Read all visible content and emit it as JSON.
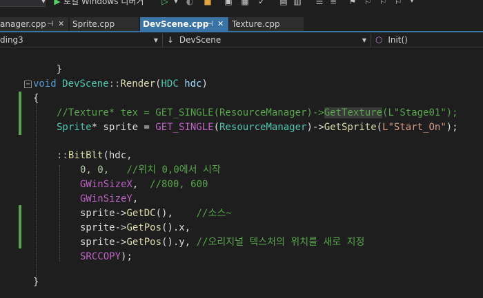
{
  "toolbar": {
    "debug_target": "로컬 Windows 디버거"
  },
  "tabs": [
    {
      "label": "anager.cpp",
      "active": false,
      "pinned": true
    },
    {
      "label": "Sprite.cpp",
      "active": false,
      "pinned": false
    },
    {
      "label": "DevScene.cpp",
      "active": true,
      "pinned": true
    },
    {
      "label": "Texture.cpp",
      "active": false,
      "pinned": false
    }
  ],
  "navbar": {
    "project": "ding3",
    "scope": "DevScene",
    "member": "Init()"
  },
  "code": {
    "l0": "}",
    "l1_void": "void",
    "l1_class": "DevScene",
    "l1_sep": "::",
    "l1_fn": "Render",
    "l1_open": "(",
    "l1_type": "HDC",
    "l1_param": " hdc",
    "l1_close": ")",
    "l2": "{",
    "l3_comment1": "//Texture* tex = GET_SINGLE(ResourceManager)->",
    "l3_comment_hl": "GetTexture",
    "l3_comment2": "(L\"Stage01\");",
    "l4_type": "Sprite",
    "l4_a": "* sprite = ",
    "l4_macro": "GET_SINGLE",
    "l4_b": "(",
    "l4_rm": "ResourceManager",
    "l4_c": ")->",
    "l4_fn": "GetSprite",
    "l4_d": "(",
    "l4_str": "L\"Start_On\"",
    "l4_e": ");",
    "l5_scope": "::",
    "l5_fn": "BitBlt",
    "l5_rest": "(hdc,",
    "l6_num": "0, 0,",
    "l6_comment": "   //위치 0,0에서 시작",
    "l7_mac": "GWinSizeX",
    "l7_rest": ",  ",
    "l7_comment": "//800, 600",
    "l8_mac": "GWinSizeY",
    "l8_rest": ",",
    "l9_a": "sprite->",
    "l9_fn": "GetDC",
    "l9_b": "(),    ",
    "l9_comment": "//소스~",
    "l10_a": "sprite->",
    "l10_fn": "GetPos",
    "l10_b": "().x,",
    "l11_a": "sprite->",
    "l11_fn": "GetPos",
    "l11_b": "().y, ",
    "l11_comment": "//오리지널 텍스처의 위치를 새로 지정",
    "l12_mac": "SRCCOPY",
    "l12_rest": ");",
    "l13": "}"
  }
}
